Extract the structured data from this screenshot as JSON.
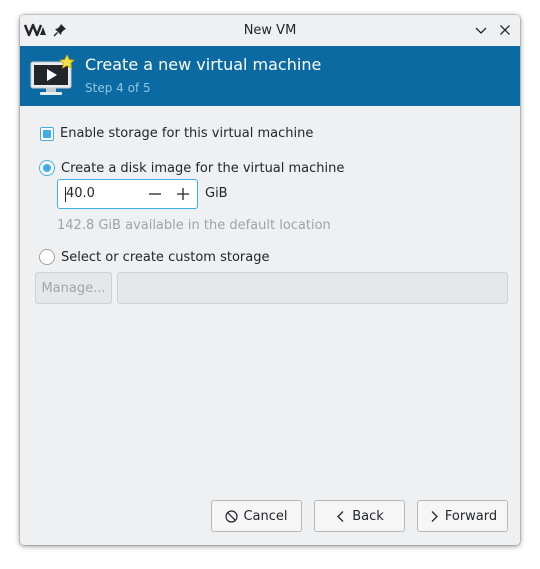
{
  "window": {
    "title": "New VM"
  },
  "header": {
    "title": "Create a new virtual machine",
    "subtitle": "Step 4 of 5"
  },
  "storage": {
    "enable_label": "Enable storage for this virtual machine",
    "enable_checked": true,
    "disk_image_label": "Create a disk image for the virtual machine",
    "disk_image_selected": true,
    "size_value": "40.0",
    "size_unit": "GiB",
    "available_hint": "142.8 GiB available in the default location",
    "custom_label": "Select or create custom storage",
    "custom_selected": false,
    "manage_label": "Manage...",
    "path_value": ""
  },
  "buttons": {
    "cancel": "Cancel",
    "back": "Back",
    "forward": "Forward"
  },
  "colors": {
    "header_bg": "#0b6aa1",
    "accent": "#3daee9",
    "window_bg": "#eff0f1"
  },
  "icons": {
    "app": "virt-manager-logo-icon",
    "pin": "pin-icon",
    "minimize": "chevron-down-icon",
    "close": "close-icon",
    "vm": "new-vm-monitor-icon",
    "cancel": "cancel-circle-icon",
    "back": "chevron-left-icon",
    "forward": "chevron-right-icon"
  }
}
